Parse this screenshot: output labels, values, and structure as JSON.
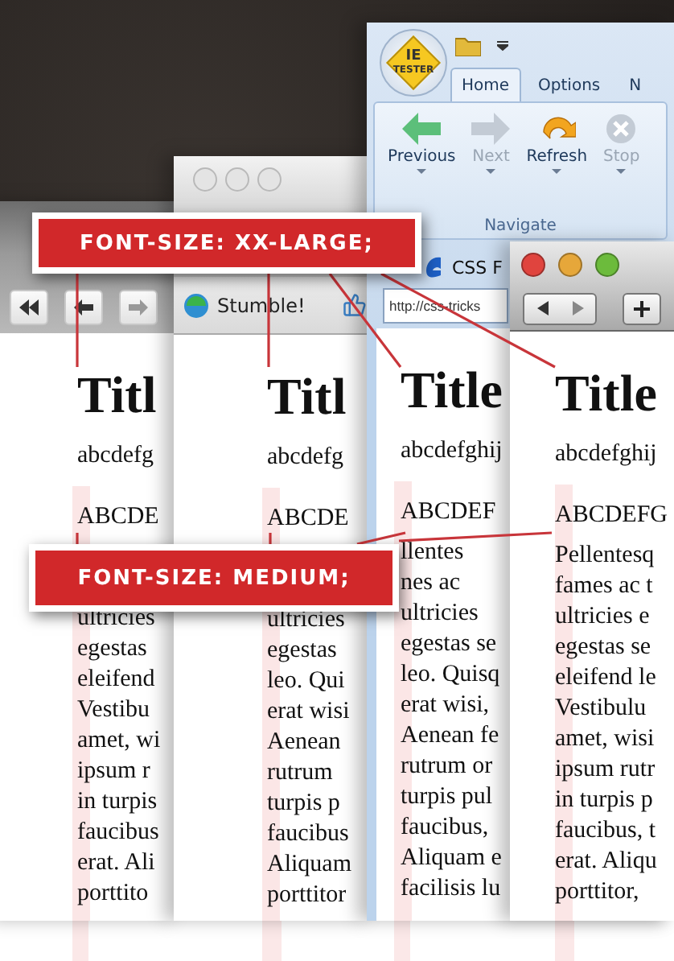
{
  "labels": [
    {
      "text": "FONT-SIZE: XX-LARGE;"
    },
    {
      "text": "FONT-SIZE: MEDIUM;"
    }
  ],
  "windows": [
    {
      "kind": "browser-gray",
      "page": {
        "heading": "Titl",
        "lowercase": "abcdefg",
        "uppercase": "ABCDE",
        "lines": [
          "ultricies",
          "egestas",
          "eleifend",
          "Vestibu",
          "amet, wi",
          "ipsum r",
          "in turpis",
          "faucibus",
          "erat. Ali",
          "porttito"
        ]
      }
    },
    {
      "kind": "browser-light",
      "bookmark": "Stumble!",
      "page": {
        "heading": "Titl",
        "lowercase": "abcdefg",
        "uppercase": "ABCDE",
        "lines": [
          "ultricies",
          "egestas",
          "leo. Qui",
          "erat wisi",
          "Aenean",
          "rutrum",
          "turpis p",
          "faucibus",
          "Aliquam",
          "porttitor"
        ]
      }
    },
    {
      "kind": "ie-tester",
      "logo": [
        "IE",
        "TESTER"
      ],
      "tabs": [
        {
          "label": "Home",
          "selected": true
        },
        {
          "label": "Options",
          "selected": false
        },
        {
          "label": "N",
          "selected": false
        }
      ],
      "buttons": [
        {
          "label": "Previous",
          "disabled": false
        },
        {
          "label": "Next",
          "disabled": true
        },
        {
          "label": "Refresh",
          "disabled": false
        },
        {
          "label": "Stop",
          "disabled": true
        }
      ],
      "group": "Navigate",
      "page_tab": "CSS F",
      "address": "http://css-tricks",
      "page": {
        "heading": "Title",
        "lowercase": "abcdefghij",
        "uppercase": "ABCDEF",
        "lines": [
          "llentes",
          "nes ac",
          "ultricies",
          "egestas se",
          "leo. Quisq",
          "erat wisi,",
          "Aenean fe",
          "rutrum or",
          "turpis pul",
          "faucibus,",
          "Aliquam e",
          "facilisis lu"
        ]
      }
    },
    {
      "kind": "safari",
      "page": {
        "heading": "Title",
        "lowercase": "abcdefghij",
        "uppercase": "ABCDEFG",
        "lines": [
          "Pellentesq",
          "fames ac t",
          "ultricies e",
          "egestas se",
          "eleifend le",
          "Vestibulu",
          "amet, wisi",
          "ipsum rutr",
          "in turpis p",
          "faucibus, t",
          "erat. Aliqu",
          "porttitor,"
        ]
      }
    }
  ]
}
